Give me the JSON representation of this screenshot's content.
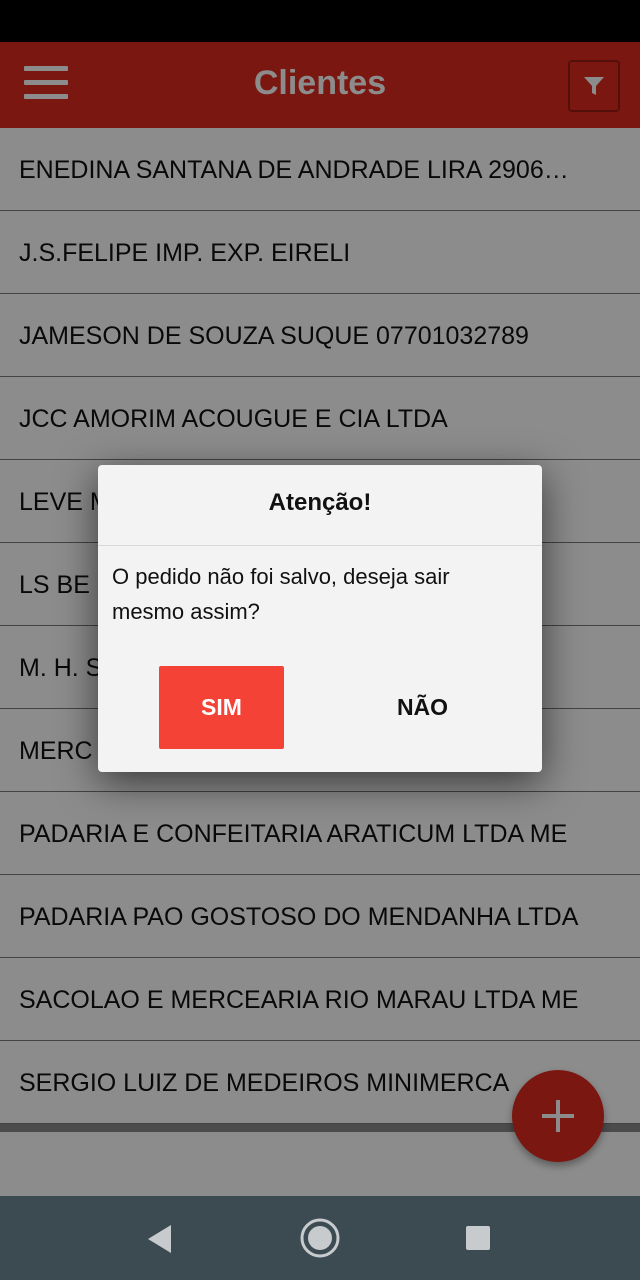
{
  "app_bar": {
    "title": "Clientes",
    "menu_icon": "hamburger-menu-icon",
    "filter_icon": "filter-funnel-icon",
    "color": "#e02a1f"
  },
  "clients": [
    {
      "name": "ENEDINA SANTANA DE ANDRADE LIRA 2906…"
    },
    {
      "name": "J.S.FELIPE IMP. EXP. EIRELI"
    },
    {
      "name": "JAMESON DE SOUZA SUQUE 07701032789"
    },
    {
      "name": "JCC AMORIM ACOUGUE E CIA LTDA"
    },
    {
      "name": "LEVE M"
    },
    {
      "name": "LS BE"
    },
    {
      "name": "M. H. S"
    },
    {
      "name": "MERC"
    },
    {
      "name": "PADARIA E CONFEITARIA ARATICUM LTDA ME"
    },
    {
      "name": "PADARIA PAO GOSTOSO DO MENDANHA LTDA"
    },
    {
      "name": "SACOLAO E MERCEARIA RIO MARAU LTDA ME"
    },
    {
      "name": "SERGIO LUIZ DE MEDEIROS MINIMERCA"
    }
  ],
  "dialog": {
    "title": "Atenção!",
    "message": "O pedido não foi salvo, deseja sair mesmo assim?",
    "confirm_label": "SIM",
    "cancel_label": "NÃO",
    "confirm_color": "#f44336"
  },
  "fab": {
    "icon": "plus-icon"
  },
  "nav": {
    "back_icon": "back-triangle-icon",
    "home_icon": "home-circle-icon",
    "recents_icon": "recents-square-icon"
  }
}
